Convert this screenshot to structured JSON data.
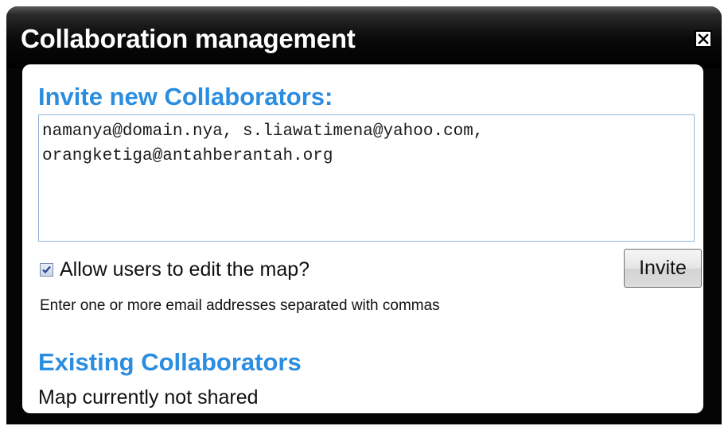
{
  "dialog": {
    "title": "Collaboration management",
    "close_icon": "close-icon"
  },
  "invite": {
    "heading": "Invite new Collaborators:",
    "emails_value": "namanya@domain.nya, s.liawatimena@yahoo.com,\norangketiga@antahberantah.org",
    "allow_edit_checked": true,
    "allow_edit_label": "Allow users to edit the map?",
    "invite_button_label": "Invite",
    "hint": "Enter one or more email addresses separated with commas"
  },
  "existing": {
    "heading": "Existing Collaborators",
    "status": "Map currently not shared"
  },
  "colors": {
    "heading_accent": "#2b8de0",
    "title_bar": "#000000",
    "checkbox_check": "#2a3f8f"
  }
}
